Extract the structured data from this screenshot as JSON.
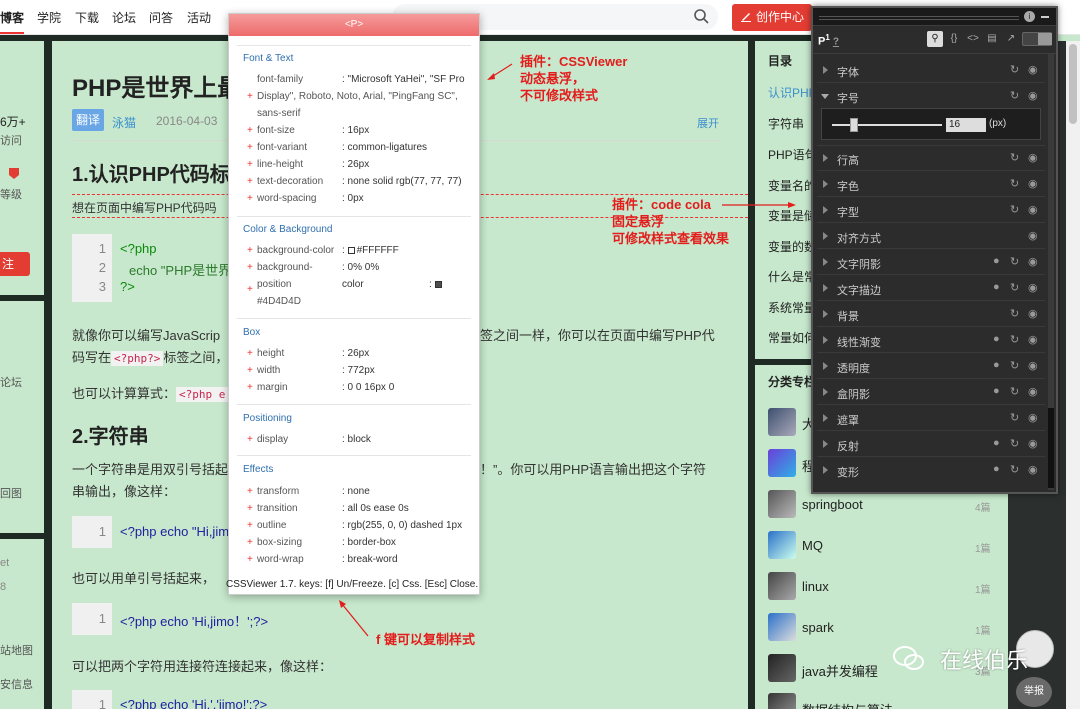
{
  "nav": {
    "items": [
      "博客",
      "学院",
      "下载",
      "论坛",
      "问答",
      "活动"
    ],
    "create_label": "创作中心"
  },
  "leftpane": {
    "texts": [
      "6万+",
      "访问",
      "等级",
      "注",
      "论坛",
      "回图",
      "et",
      "8",
      "站地图",
      "安信息"
    ]
  },
  "article": {
    "title": "PHP是世界上最",
    "badge": "翻译",
    "author": "泳猫",
    "date": "2016-04-03",
    "expand": "展开",
    "h1": "1.认识PHP代码标",
    "p1": "想在页面中编写PHP代码吗",
    "code1": [
      {
        "n": "1",
        "text": "<?php"
      },
      {
        "n": "2",
        "text": "echo \"PHP是世界"
      },
      {
        "n": "3",
        "text": "?>"
      }
    ],
    "p2a": "就像你可以编写JavaScrip",
    "p2b": "签之间一样，你可以在页面中编写PHP代",
    "p2c": "码写在",
    "p2code": "<?php?>",
    "p2d": "标签之间，",
    "p3": "也可以计算算式：",
    "p3code": "<?php e",
    "h2": "2.字符串",
    "p4a": "一个字符串是用双引号括起",
    "p4b": "！”。你可以用PHP语言输出把这个字符",
    "p4c": "串输出，像这样：",
    "code2": [
      {
        "n": "1",
        "text": "<?php echo \"Hi,jimo"
      }
    ],
    "p5": "也可以用单引号括起来，",
    "code3": [
      {
        "n": "1",
        "text": "<?php echo 'Hi,jimo！';?>"
      }
    ],
    "p6": "可以把两个字符用连接符连接起来，像这样：",
    "code4": [
      {
        "n": "1",
        "text": "<?php echo 'Hi,'.'jimo!';?>"
      }
    ]
  },
  "sidebar": {
    "toc_title": "目录",
    "toc": [
      "认识PHP",
      "字符串",
      "PHP语句",
      "变量名的",
      "变量是储",
      "变量的数",
      "什么是常",
      "系统常量",
      "常量如何"
    ],
    "category_title": "分类专栏",
    "categories": [
      {
        "name": "大",
        "count": ""
      },
      {
        "name": "程",
        "count": ""
      },
      {
        "name": "springboot",
        "count": "4篇"
      },
      {
        "name": "MQ",
        "count": "1篇"
      },
      {
        "name": "linux",
        "count": "1篇"
      },
      {
        "name": "spark",
        "count": "1篇"
      },
      {
        "name": "java并发编程",
        "count": "3篇"
      },
      {
        "name": "数据结构与算法",
        "count": "8篇"
      }
    ]
  },
  "cssviewer": {
    "header": "<P>",
    "sec_font": "Font & Text",
    "font_rows": [
      {
        "k": "font-family",
        "v": ": \"Microsoft YaHei\", \"SF Pro"
      },
      {
        "k": "Display\", Roboto, Noto, Arial, \"PingFang SC\",",
        "v": ""
      },
      {
        "k": "sans-serif",
        "v": ""
      },
      {
        "k": "font-size",
        "v": ": 16px"
      },
      {
        "k": "font-variant",
        "v": ": common-ligatures"
      },
      {
        "k": "line-height",
        "v": ": 26px"
      },
      {
        "k": "text-decoration",
        "v": ": none solid rgb(77, 77, 77)"
      },
      {
        "k": "word-spacing",
        "v": ": 0px"
      }
    ],
    "sec_color": "Color & Background",
    "color_rows": [
      {
        "k": "background-color",
        "v": "#FFFFFF"
      },
      {
        "k": "background-",
        "v": ": 0% 0%"
      },
      {
        "k": "position",
        "v": "color"
      },
      {
        "k": "#4D4D4D",
        "v": ""
      }
    ],
    "sec_box": "Box",
    "box_rows": [
      {
        "k": "height",
        "v": ": 26px"
      },
      {
        "k": "width",
        "v": ": 772px"
      },
      {
        "k": "margin",
        "v": ": 0 0 16px 0"
      }
    ],
    "sec_pos": "Positioning",
    "pos_rows": [
      {
        "k": "display",
        "v": ": block"
      }
    ],
    "sec_eff": "Effects",
    "eff_rows": [
      {
        "k": "transform",
        "v": ": none"
      },
      {
        "k": "transition",
        "v": ": all 0s ease 0s"
      },
      {
        "k": "outline",
        "v": ": rgb(255, 0, 0) dashed 1px"
      },
      {
        "k": "box-sizing",
        "v": ": border-box"
      },
      {
        "k": "word-wrap",
        "v": ": break-word"
      }
    ],
    "footer": "CSSViewer 1.7. keys: [f] Un/Freeze. [c] Css. [Esc] Close."
  },
  "annotations": {
    "a1": [
      "插件：CSSViewer",
      "动态悬浮，",
      "不可修改样式"
    ],
    "a2": [
      "插件：code cola",
      "固定悬浮",
      "可修改样式查看效果"
    ],
    "a3": "f 键可以复制样式"
  },
  "codecola": {
    "element": "P",
    "element_sub": "1",
    "help": "?",
    "slider_value": "16",
    "slider_unit": "(px)",
    "rows": [
      "字体",
      "字号",
      "行高",
      "字色",
      "字型",
      "对齐方式",
      "文字阴影",
      "文字描边",
      "背景",
      "线性渐变",
      "透明度",
      "盒阴影",
      "遮罩",
      "反射",
      "变形"
    ]
  },
  "watermark": "在线伯乐",
  "report": "举报",
  "colors": {
    "accent": "#e33d33",
    "page_bg": "#c7e8cc",
    "annotation": "#e31c1c",
    "link": "#3b8fd0"
  }
}
